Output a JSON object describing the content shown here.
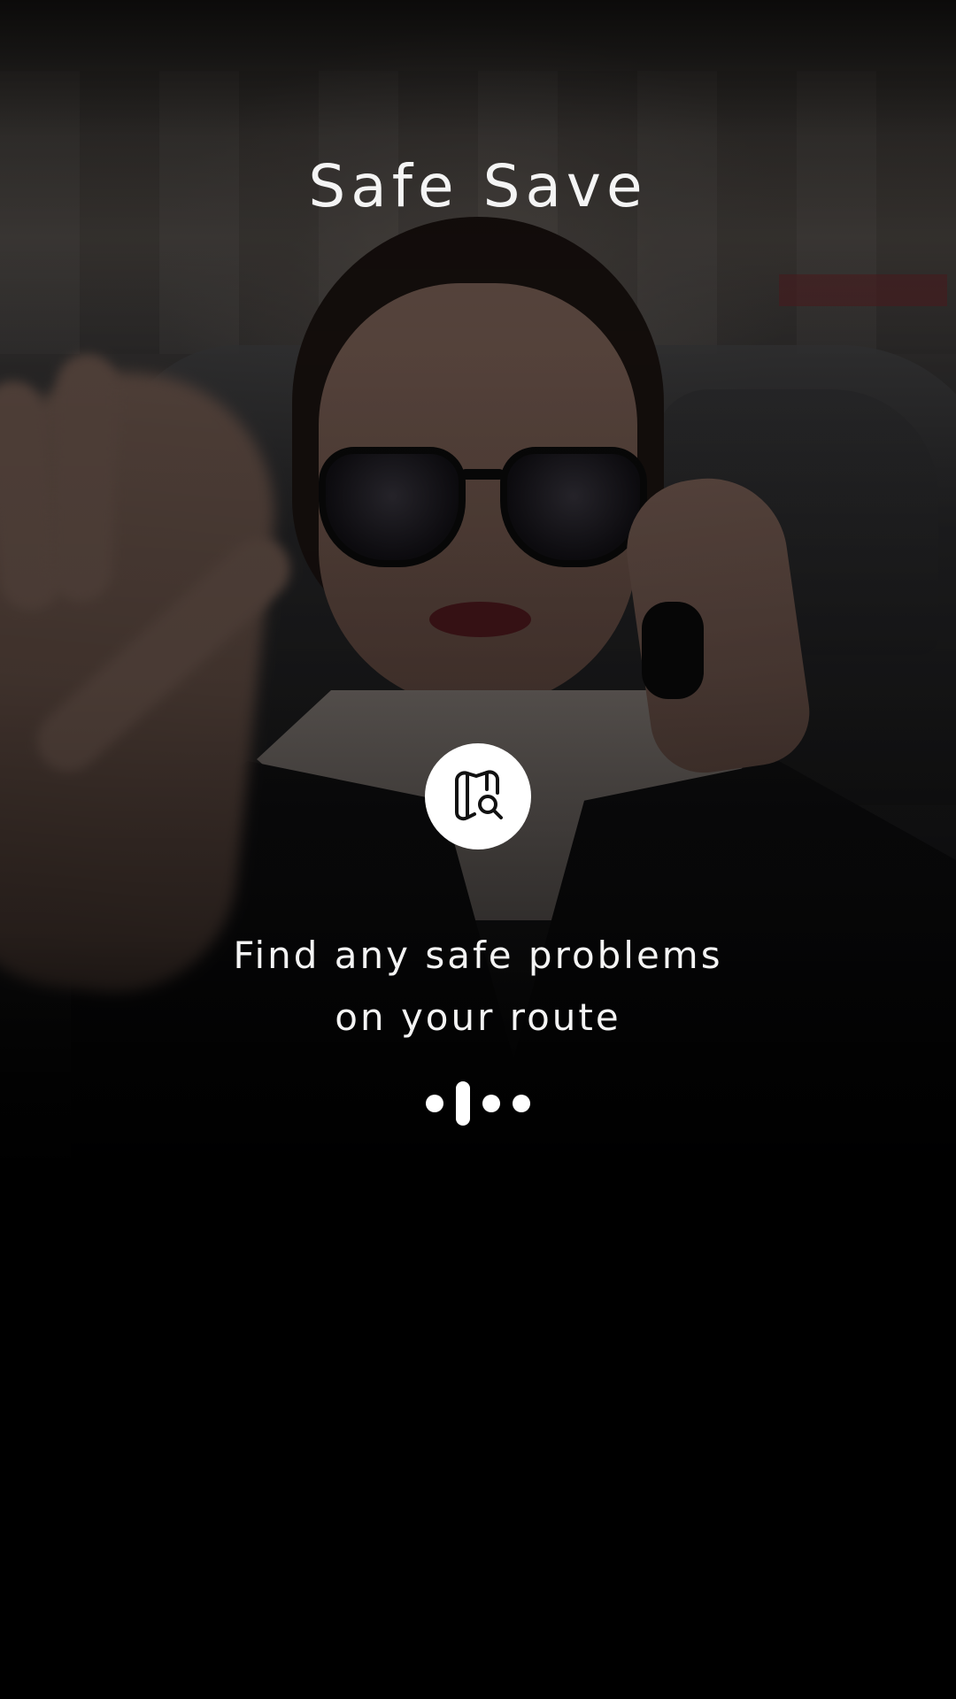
{
  "app": {
    "title": "Safe Save"
  },
  "onboarding": {
    "icon": "map-search-icon",
    "tagline_line1": "Find any safe problems",
    "tagline_line2": "on your route",
    "pager": {
      "total": 4,
      "active_index": 1
    }
  },
  "colors": {
    "background": "#000000",
    "text": "#f4f4f4",
    "icon_circle": "#ffffff",
    "icon_stroke": "#111111"
  }
}
